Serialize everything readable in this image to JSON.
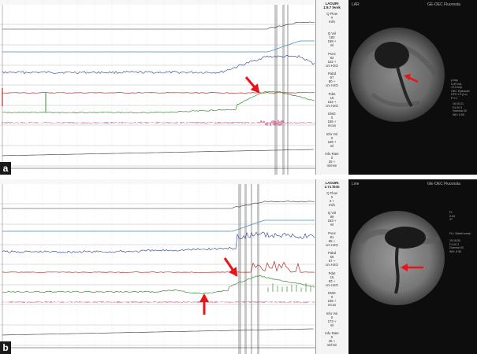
{
  "panels": [
    {
      "letter": "a",
      "header": "LAOURI\n1:9.7 ferek",
      "channels": [
        {
          "label": "Q Flow\n#\nml/s",
          "color": "#333333"
        },
        {
          "label": "Q Vol\n183\n189 +\nml",
          "color": "#4a8fbf"
        },
        {
          "label": "Pves\n82\n152 +\ncm H2O",
          "color": "#2b3a8f"
        },
        {
          "label": "Pabd\n67\n80 +\ncm H2O",
          "color": "#b0302a"
        },
        {
          "label": "Pdet\n15\n152 +\ncm H2O",
          "color": "#3f8a3a"
        },
        {
          "label": "EMG\n0\n165 +\nmcus",
          "color": "#c2185b"
        },
        {
          "label": "Infu Vol\n0\n189 +\nml",
          "color": "#333333"
        },
        {
          "label": "Infu Rate\n0\n25 +\nml/min",
          "color": "#333333"
        }
      ],
      "fluoro": {
        "top_left": "LAR",
        "top_right": "GE-OEC Fluorosta",
        "side": "p.hsp\n0.49 mA\n72.5 kVp\nOEC Hydraulic\nHFS 1.3 (Lo)\nP 0.1",
        "bottom_side": "16:19:21\nF4.00 3\nGamma 00\nWH: 6 50"
      }
    },
    {
      "letter": "b",
      "header": "LAOURI\n1:71 hieb",
      "channels": [
        {
          "label": "Q Flow\n0\n4 +\nml/s",
          "color": "#333333"
        },
        {
          "label": "Q Vol\n86\n183 +\nml",
          "color": "#4a8fbf"
        },
        {
          "label": "Pves\n81\n65 +\ncm H2O",
          "color": "#2b3a8f"
        },
        {
          "label": "Pabd\n65\n67 +\ncm H2O",
          "color": "#b0302a"
        },
        {
          "label": "Pdet\n15\n83 +\ncm H2O",
          "color": "#3f8a3a"
        },
        {
          "label": "EMG\n0\n165 +\nmcus",
          "color": "#c2185b"
        },
        {
          "label": "Infu Vol\n0\n173 +\nml",
          "color": "#333333"
        },
        {
          "label": "Infu Rate\n0\n46 +\nml/min",
          "color": "#333333"
        }
      ],
      "fluoro": {
        "top_left": "Line",
        "top_right": "GE-OEC Fluorosta",
        "side": "FL\n0.64\n37\n\n\n\nFLI: WiseKonrad\n\n15:16:53\nF4.00 2\nGamma 00\nWH: 8 50",
        "bottom_side": ""
      }
    }
  ],
  "colors": {
    "arrow": "#e8141b",
    "flow": "#333333",
    "vol": "#4a8fbf",
    "pves": "#2b3a8f",
    "pabd": "#b0302a",
    "pdet": "#3f8a3a",
    "emg": "#c2185b"
  }
}
